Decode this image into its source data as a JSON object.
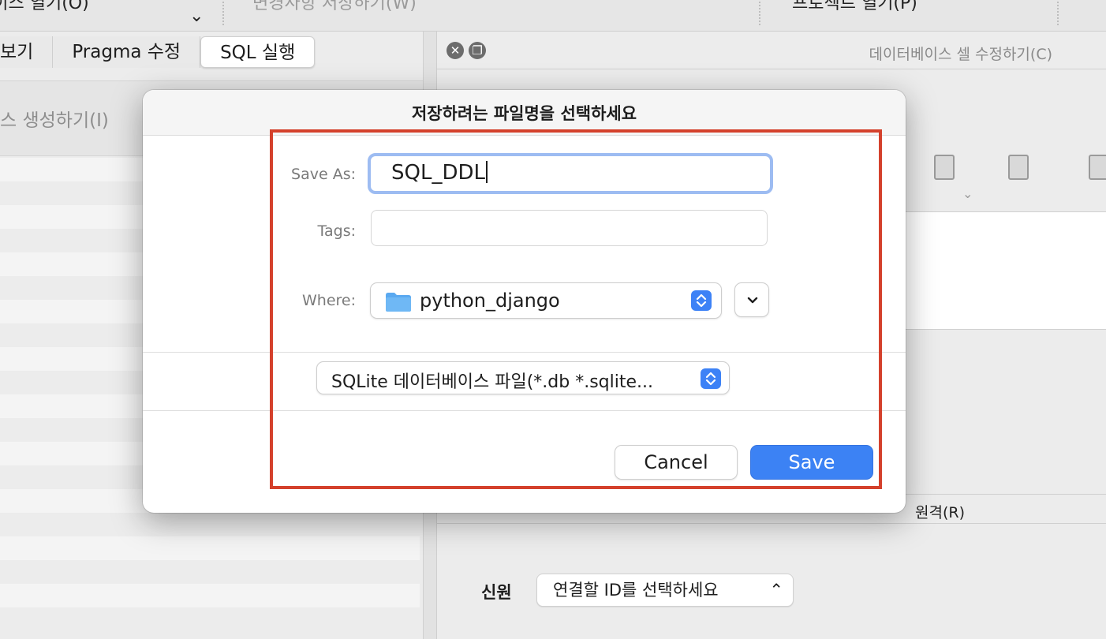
{
  "toolbar": {
    "open_db_label": "베이스 열기(O)",
    "write_changes_label": "변경사항 저장하기(W)",
    "open_project_label": "프로젝트 열기(P)"
  },
  "left_pane": {
    "tabs": [
      {
        "label": "보기"
      },
      {
        "label": "Pragma 수정"
      },
      {
        "label": "SQL 실행"
      }
    ],
    "create_index_label": "스 생성하기(I)"
  },
  "right_pane": {
    "edit_cell_title": "데이터베이스 셀 수정하기(C)",
    "remote_label": "원격(R)",
    "source_label": "신원",
    "identity_select": "연결할 ID를 선택하세요"
  },
  "dialog": {
    "title": "저장하려는 파일명을 선택하세요",
    "save_as_label": "Save As:",
    "save_as_value": "SQL_DDL",
    "tags_label": "Tags:",
    "tags_value": "",
    "where_label": "Where:",
    "where_value": "python_django",
    "file_format": "SQLite 데이터베이스 파일(*.db *.sqlite...",
    "cancel_label": "Cancel",
    "save_label": "Save"
  },
  "colors": {
    "accent": "#3c82f4",
    "highlight": "#d4412c",
    "focus_ring": "#9dbcf2"
  }
}
